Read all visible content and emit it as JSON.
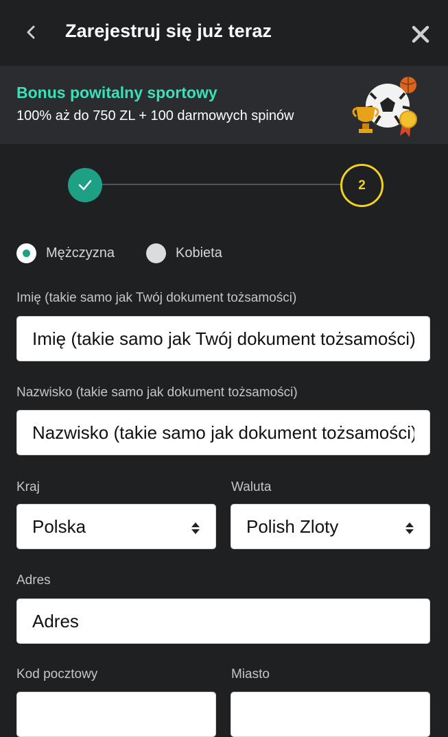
{
  "header": {
    "title": "Zarejestruj się już teraz"
  },
  "bonus": {
    "title": "Bonus powitalny sportowy",
    "description": "100% aż do 750 ZL + 100 darmowych spinów"
  },
  "stepper": {
    "current_step": "2",
    "completed_steps": 1
  },
  "gender": {
    "options": [
      "Mężczyzna",
      "Kobieta"
    ],
    "selected": "Mężczyzna"
  },
  "form": {
    "first_name": {
      "label": "Imię (takie samo jak Twój dokument tożsamości)",
      "placeholder": "Imię  (takie samo jak Twój dokument tożsamości)"
    },
    "last_name": {
      "label": "Nazwisko (takie samo jak dokument tożsamości)",
      "placeholder": "Nazwisko (takie samo jak dokument tożsamości)"
    },
    "country": {
      "label": "Kraj",
      "value": "Polska"
    },
    "currency": {
      "label": "Waluta",
      "value": "Polish Zloty"
    },
    "address": {
      "label": "Adres",
      "placeholder": "Adres"
    },
    "postal_code": {
      "label": "Kod pocztowy"
    },
    "city": {
      "label": "Miasto"
    }
  },
  "colors": {
    "accent_green": "#1ea085",
    "bonus_title": "#3be0b8",
    "current_step": "#f5d020",
    "background": "#1f2022"
  },
  "icons": {
    "back": "chevron-left-icon",
    "close": "close-icon",
    "step_done": "checkmark-icon",
    "select": "sort-arrows-icon",
    "bonus_art": "soccer-trophy-illustration"
  }
}
